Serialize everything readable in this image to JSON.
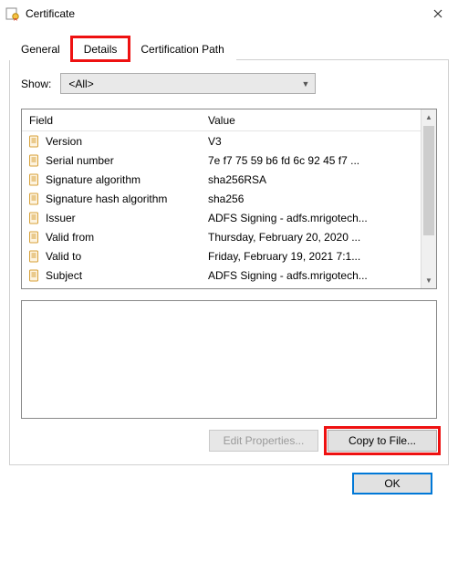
{
  "window": {
    "title": "Certificate"
  },
  "tabs": {
    "general": "General",
    "details": "Details",
    "certpath": "Certification Path"
  },
  "show": {
    "label": "Show:",
    "selected": "<All>"
  },
  "columns": {
    "field": "Field",
    "value": "Value"
  },
  "rows": [
    {
      "field": "Version",
      "value": "V3"
    },
    {
      "field": "Serial number",
      "value": "7e f7 75 59 b6 fd 6c 92 45 f7 ..."
    },
    {
      "field": "Signature algorithm",
      "value": "sha256RSA"
    },
    {
      "field": "Signature hash algorithm",
      "value": "sha256"
    },
    {
      "field": "Issuer",
      "value": "ADFS Signing - adfs.mrigotech..."
    },
    {
      "field": "Valid from",
      "value": "Thursday, February 20, 2020 ..."
    },
    {
      "field": "Valid to",
      "value": "Friday, February 19, 2021 7:1..."
    },
    {
      "field": "Subject",
      "value": "ADFS Signing - adfs.mrigotech..."
    }
  ],
  "buttons": {
    "edit": "Edit Properties...",
    "copy": "Copy to File...",
    "ok": "OK"
  }
}
